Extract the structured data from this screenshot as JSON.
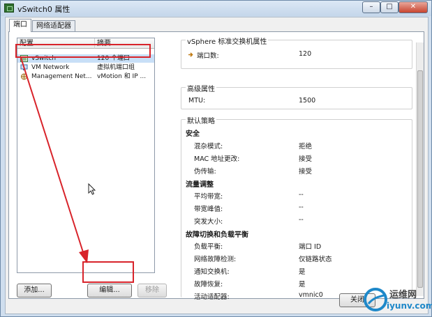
{
  "window": {
    "title": "vSwitch0 属性"
  },
  "window_buttons": {
    "minimize": "–",
    "maximize": "□",
    "close": "✕"
  },
  "tabs": [
    {
      "label": "端口"
    },
    {
      "label": "网络适配器"
    }
  ],
  "list": {
    "columns": [
      "配置",
      "摘要"
    ],
    "rows": [
      {
        "name": "vSwitch",
        "summary": "120 个端口",
        "icon": "vswitch-icon",
        "selected": true
      },
      {
        "name": "VM Network",
        "summary": "虚拟机端口组",
        "icon": "vm-network-icon",
        "selected": false
      },
      {
        "name": "Management Net...",
        "summary": "vMotion 和 IP ...",
        "icon": "management-network-icon",
        "selected": false
      }
    ]
  },
  "buttons": {
    "add": "添加...",
    "edit": "编辑...",
    "remove": "移除",
    "close": "关闭"
  },
  "properties": {
    "standard": {
      "title": "vSphere 标准交换机属性",
      "port_count_label": "端口数:",
      "port_count_value": "120"
    },
    "advanced": {
      "title": "高级属性",
      "mtu_label": "MTU:",
      "mtu_value": "1500"
    },
    "default_policy": {
      "title": "默认策略",
      "security": {
        "heading": "安全",
        "rows": [
          {
            "label": "混杂模式:",
            "value": "拒绝"
          },
          {
            "label": "MAC 地址更改:",
            "value": "接受"
          },
          {
            "label": "伪传输:",
            "value": "接受"
          }
        ]
      },
      "traffic_shaping": {
        "heading": "流量调整",
        "rows": [
          {
            "label": "平均带宽:",
            "value": "--"
          },
          {
            "label": "带宽峰值:",
            "value": "--"
          },
          {
            "label": "突发大小:",
            "value": "--"
          }
        ]
      },
      "failover": {
        "heading": "故障切换和负载平衡",
        "rows": [
          {
            "label": "负载平衡:",
            "value": "端口 ID"
          },
          {
            "label": "网络故障检测:",
            "value": "仅链路状态"
          },
          {
            "label": "通知交换机:",
            "value": "是"
          },
          {
            "label": "故障恢复:",
            "value": "是"
          },
          {
            "label": "活动适配器:",
            "value": "vmnic0"
          }
        ]
      }
    }
  },
  "watermark": {
    "name": "运维网",
    "url": "iyunv.com"
  },
  "colors": {
    "highlight": "#d8232a",
    "selection": "#c8dff7"
  }
}
